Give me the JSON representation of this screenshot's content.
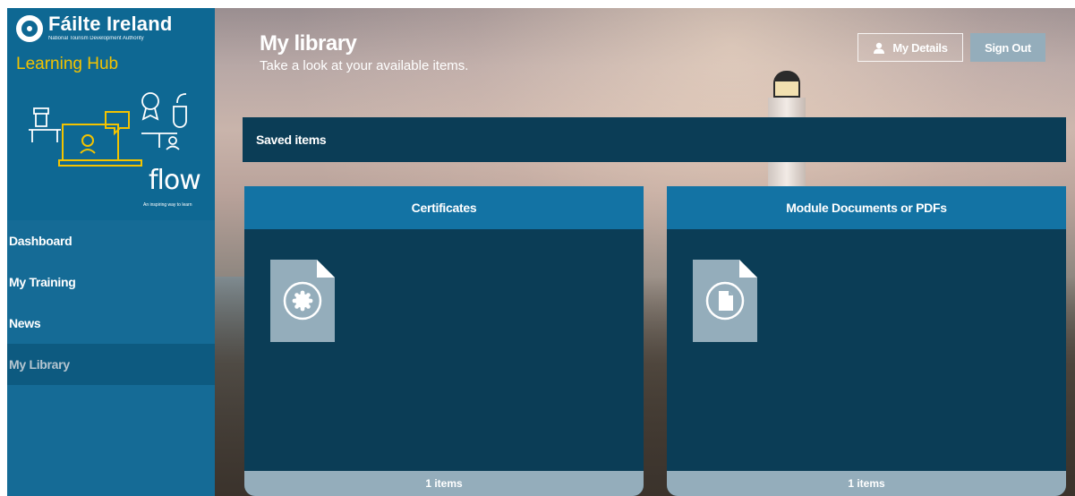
{
  "brand": {
    "name": "Fáilte Ireland",
    "subtitle": "National Tourism Development Authority",
    "hub": "Learning Hub",
    "flow_word": "flow",
    "flow_tagline": "An inspiring way to learn"
  },
  "sidebar": {
    "items": [
      {
        "label": "Dashboard",
        "active": false
      },
      {
        "label": "My Training",
        "active": false
      },
      {
        "label": "News",
        "active": false
      },
      {
        "label": "My Library",
        "active": true
      }
    ]
  },
  "header": {
    "title": "My library",
    "subtitle": "Take a look at your available items.",
    "details_label": "My Details",
    "signout_label": "Sign Out"
  },
  "saved": {
    "title": "Saved items"
  },
  "cards": [
    {
      "title": "Certificates",
      "icon": "certificate-seal-icon",
      "count_label": "1 items"
    },
    {
      "title": "Module Documents or PDFs",
      "icon": "document-icon",
      "count_label": "1 items"
    }
  ],
  "colors": {
    "sidebar": "#156b96",
    "panel": "#0b3d56",
    "card_header": "#1373a4",
    "muted_button": "#94adbb",
    "hub_title": "#f3c300"
  }
}
